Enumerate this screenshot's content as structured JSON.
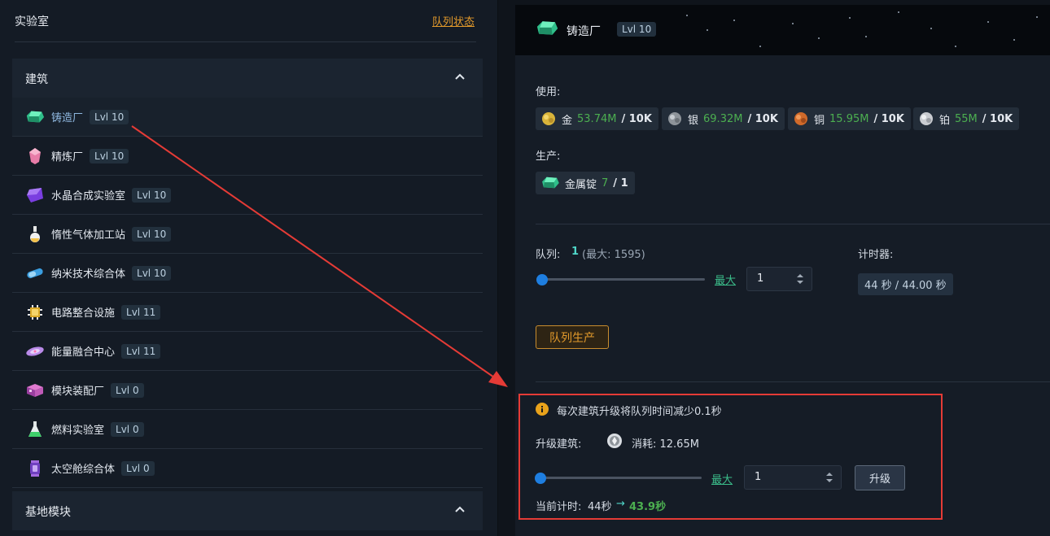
{
  "left": {
    "title": "实验室",
    "queue_status": "队列状态",
    "section_buildings": "建筑",
    "section_base": "基地模块",
    "items": [
      {
        "name": "铸造厂",
        "lvl": "Lvl 10",
        "icon": "emerald-ingot-icon",
        "active": true
      },
      {
        "name": "精炼厂",
        "lvl": "Lvl 10",
        "icon": "pink-crystal-icon"
      },
      {
        "name": "水晶合成实验室",
        "lvl": "Lvl 10",
        "icon": "purple-crystal-icon"
      },
      {
        "name": "惰性气体加工站",
        "lvl": "Lvl 10",
        "icon": "gas-flask-icon"
      },
      {
        "name": "纳米技术综合体",
        "lvl": "Lvl 10",
        "icon": "nano-capsule-icon"
      },
      {
        "name": "电路整合设施",
        "lvl": "Lvl 11",
        "icon": "chip-icon"
      },
      {
        "name": "能量融合中心",
        "lvl": "Lvl 11",
        "icon": "energy-disc-icon"
      },
      {
        "name": "模块装配厂",
        "lvl": "Lvl 0",
        "icon": "module-box-icon"
      },
      {
        "name": "燃料实验室",
        "lvl": "Lvl 0",
        "icon": "fuel-flask-icon"
      },
      {
        "name": "太空舱综合体",
        "lvl": "Lvl 0",
        "icon": "space-pod-icon"
      }
    ]
  },
  "right": {
    "title": "铸造厂",
    "lvl": "Lvl 10",
    "use_label": "使用:",
    "resources": [
      {
        "name": "金",
        "val": "53.74M",
        "max": "/ 10K",
        "color": "#d9b43a",
        "icon": "gold-ore-icon"
      },
      {
        "name": "银",
        "val": "69.32M",
        "max": "/ 10K",
        "color": "#9aa0a6",
        "icon": "silver-ore-icon"
      },
      {
        "name": "铜",
        "val": "15.95M",
        "max": "/ 10K",
        "color": "#d06a2a",
        "icon": "copper-ore-icon"
      },
      {
        "name": "铂",
        "val": "55M",
        "max": "/ 10K",
        "color": "#c9ccd1",
        "icon": "platinum-ore-icon"
      }
    ],
    "produce_label": "生产:",
    "product": {
      "name": "金属锭",
      "val": "7",
      "max": "/ 1"
    },
    "queue_label": "队列:",
    "queue_value": "1",
    "queue_max": "(最大: 1595)",
    "max_link": "最大",
    "queue_input": "1",
    "timer_label": "计时器:",
    "timer_value": "44 秒 / 44.00 秒",
    "queue_button": "队列生产",
    "info_text": "每次建筑升级将队列时间减少0.1秒",
    "upgrade_label": "升级建筑:",
    "cost_text": "消耗: 12.65M",
    "upgrade_max_link": "最大",
    "upgrade_input": "1",
    "upgrade_button": "升级",
    "current_timer_label": "当前计时:",
    "current_timer_value": "44秒",
    "arrow": "→",
    "next_timer_value": "43.9秒"
  },
  "colors": {
    "accent_orange": "#e39a2b",
    "accent_green": "#4caf50",
    "slider_blue": "#1e7ee0",
    "highlight_red": "#e53b36"
  }
}
